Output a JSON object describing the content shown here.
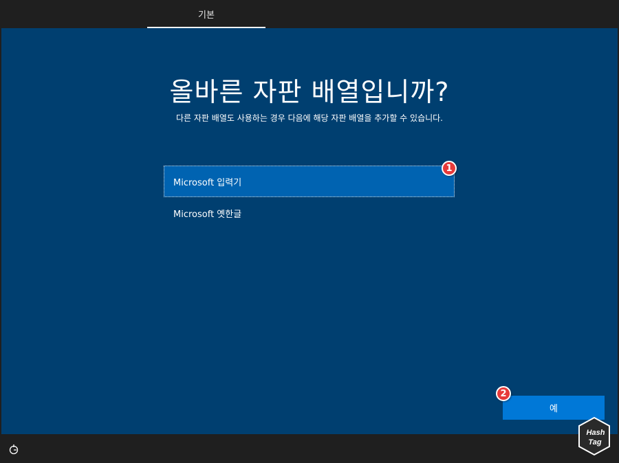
{
  "header": {
    "tab_label": "기본"
  },
  "main": {
    "title": "올바른 자판 배열입니까?",
    "subtitle": "다른 자판 배열도 사용하는 경우 다음에 해당 자판 배열을 추가할 수 있습니다.",
    "layouts": [
      {
        "label": "Microsoft 입력기",
        "selected": true
      },
      {
        "label": "Microsoft 옛한글",
        "selected": false
      }
    ],
    "yes_label": "예"
  },
  "annotations": {
    "badge_1": "1",
    "badge_2": "2"
  },
  "watermark": {
    "text_line1": "Hash",
    "text_line2": "Tag"
  },
  "colors": {
    "background": "#003f70",
    "selected_item": "#0063b1",
    "primary_button": "#0078d7",
    "chrome": "#1f1f1f",
    "badge": "#e63a3a"
  },
  "icons": {
    "accessibility": "ease-of-access-icon"
  }
}
